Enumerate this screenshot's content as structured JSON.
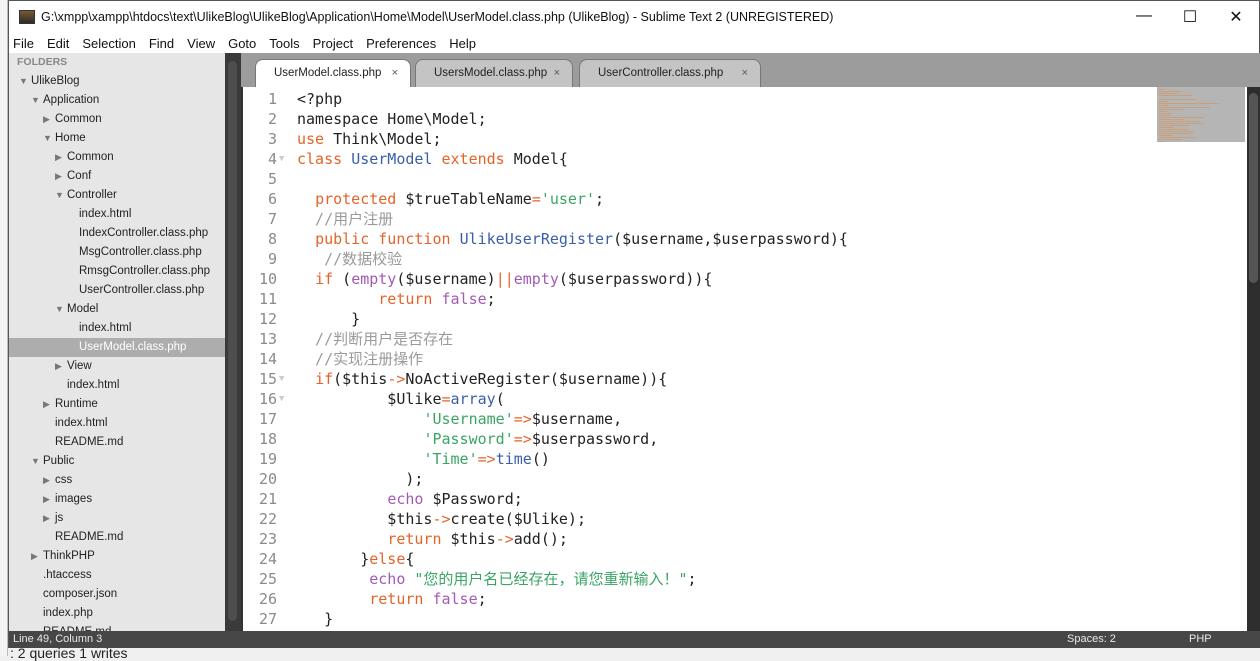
{
  "window": {
    "title": "G:\\xmpp\\xampp\\htdocs\\text\\UlikeBlog\\UlikeBlog\\Application\\Home\\Model\\UserModel.class.php (UlikeBlog) - Sublime Text 2 (UNREGISTERED)",
    "minimize": "—",
    "maximize": "☐",
    "close": "✕"
  },
  "menu": [
    "File",
    "Edit",
    "Selection",
    "Find",
    "View",
    "Goto",
    "Tools",
    "Project",
    "Preferences",
    "Help"
  ],
  "sidebar": {
    "header": "FOLDERS",
    "items": [
      {
        "label": "UlikeBlog",
        "depth": 0,
        "type": "open"
      },
      {
        "label": "Application",
        "depth": 1,
        "type": "open"
      },
      {
        "label": "Common",
        "depth": 2,
        "type": "closed"
      },
      {
        "label": "Home",
        "depth": 2,
        "type": "open"
      },
      {
        "label": "Common",
        "depth": 3,
        "type": "closed"
      },
      {
        "label": "Conf",
        "depth": 3,
        "type": "closed"
      },
      {
        "label": "Controller",
        "depth": 3,
        "type": "open"
      },
      {
        "label": "index.html",
        "depth": 4,
        "type": "file"
      },
      {
        "label": "IndexController.class.php",
        "depth": 4,
        "type": "file"
      },
      {
        "label": "MsgController.class.php",
        "depth": 4,
        "type": "file"
      },
      {
        "label": "RmsgController.class.php",
        "depth": 4,
        "type": "file"
      },
      {
        "label": "UserController.class.php",
        "depth": 4,
        "type": "file"
      },
      {
        "label": "Model",
        "depth": 3,
        "type": "open"
      },
      {
        "label": "index.html",
        "depth": 4,
        "type": "file"
      },
      {
        "label": "UserModel.class.php",
        "depth": 4,
        "type": "file",
        "selected": true
      },
      {
        "label": "View",
        "depth": 3,
        "type": "closed"
      },
      {
        "label": "index.html",
        "depth": 3,
        "type": "file"
      },
      {
        "label": "Runtime",
        "depth": 2,
        "type": "closed"
      },
      {
        "label": "index.html",
        "depth": 2,
        "type": "file"
      },
      {
        "label": "README.md",
        "depth": 2,
        "type": "file"
      },
      {
        "label": "Public",
        "depth": 1,
        "type": "open"
      },
      {
        "label": "css",
        "depth": 2,
        "type": "closed"
      },
      {
        "label": "images",
        "depth": 2,
        "type": "closed"
      },
      {
        "label": "js",
        "depth": 2,
        "type": "closed"
      },
      {
        "label": "README.md",
        "depth": 2,
        "type": "file"
      },
      {
        "label": "ThinkPHP",
        "depth": 1,
        "type": "closed"
      },
      {
        "label": ".htaccess",
        "depth": 1,
        "type": "file"
      },
      {
        "label": "composer.json",
        "depth": 1,
        "type": "file"
      },
      {
        "label": "index.php",
        "depth": 1,
        "type": "file"
      },
      {
        "label": "README.md",
        "depth": 1,
        "type": "file"
      }
    ]
  },
  "tabs": [
    {
      "label": "UserModel.class.php",
      "active": true,
      "close": "×"
    },
    {
      "label": "UsersModel.class.php",
      "close": "×"
    },
    {
      "label": "UserController.class.php",
      "close": "×"
    }
  ],
  "editor": {
    "lines": [
      {
        "n": 1,
        "t": [
          [
            "pl",
            "<?php"
          ]
        ]
      },
      {
        "n": 2,
        "t": [
          [
            "pl",
            "namespace Home\\Model;"
          ]
        ]
      },
      {
        "n": 3,
        "t": [
          [
            "kw",
            "use"
          ],
          [
            "pl",
            " Think\\Model;"
          ]
        ]
      },
      {
        "n": 4,
        "fold": true,
        "t": [
          [
            "kw",
            "class"
          ],
          [
            "pl",
            " "
          ],
          [
            "fn",
            "UserModel"
          ],
          [
            "pl",
            " "
          ],
          [
            "kw",
            "extends"
          ],
          [
            "pl",
            " Model{"
          ]
        ]
      },
      {
        "n": 5,
        "t": []
      },
      {
        "n": 6,
        "t": [
          [
            "pl",
            "  "
          ],
          [
            "kw",
            "protected"
          ],
          [
            "pl",
            " $trueTableName"
          ],
          [
            "op",
            "="
          ],
          [
            "st",
            "'user'"
          ],
          [
            "pl",
            ";"
          ]
        ]
      },
      {
        "n": 7,
        "t": [
          [
            "cm",
            "  //用户注册"
          ]
        ]
      },
      {
        "n": 8,
        "t": [
          [
            "pl",
            "  "
          ],
          [
            "kw",
            "public"
          ],
          [
            "pl",
            " "
          ],
          [
            "kw",
            "function"
          ],
          [
            "pl",
            " "
          ],
          [
            "fn",
            "UlikeUserRegister"
          ],
          [
            "pl",
            "($username,$userpassword){"
          ]
        ]
      },
      {
        "n": 9,
        "t": [
          [
            "cm",
            "   //数据校验"
          ]
        ]
      },
      {
        "n": 10,
        "t": [
          [
            "pl",
            "  "
          ],
          [
            "kw",
            "if"
          ],
          [
            "pl",
            " ("
          ],
          [
            "pu",
            "empty"
          ],
          [
            "pl",
            "($username)"
          ],
          [
            "op",
            "||"
          ],
          [
            "pu",
            "empty"
          ],
          [
            "pl",
            "($userpassword)){"
          ]
        ]
      },
      {
        "n": 11,
        "t": [
          [
            "pl",
            "         "
          ],
          [
            "kw",
            "return"
          ],
          [
            "pl",
            " "
          ],
          [
            "pu",
            "false"
          ],
          [
            "pl",
            ";"
          ]
        ]
      },
      {
        "n": 12,
        "t": [
          [
            "pl",
            "      }"
          ]
        ]
      },
      {
        "n": 13,
        "t": [
          [
            "cm",
            "  //判断用户是否存在"
          ]
        ]
      },
      {
        "n": 14,
        "t": [
          [
            "cm",
            "  //实现注册操作"
          ]
        ]
      },
      {
        "n": 15,
        "fold": true,
        "t": [
          [
            "pl",
            "  "
          ],
          [
            "kw",
            "if"
          ],
          [
            "pl",
            "($this"
          ],
          [
            "op",
            "->"
          ],
          [
            "pl",
            "NoActiveRegister($username)){"
          ]
        ]
      },
      {
        "n": 16,
        "fold": true,
        "t": [
          [
            "pl",
            "          $Ulike"
          ],
          [
            "op",
            "="
          ],
          [
            "fn",
            "array"
          ],
          [
            "pl",
            "("
          ]
        ]
      },
      {
        "n": 17,
        "t": [
          [
            "pl",
            "              "
          ],
          [
            "st",
            "'Username'"
          ],
          [
            "op",
            "=>"
          ],
          [
            "pl",
            "$username,"
          ]
        ]
      },
      {
        "n": 18,
        "t": [
          [
            "pl",
            "              "
          ],
          [
            "st",
            "'Password'"
          ],
          [
            "op",
            "=>"
          ],
          [
            "pl",
            "$userpassword,"
          ]
        ]
      },
      {
        "n": 19,
        "t": [
          [
            "pl",
            "              "
          ],
          [
            "st",
            "'Time'"
          ],
          [
            "op",
            "=>"
          ],
          [
            "fn",
            "time"
          ],
          [
            "pl",
            "()"
          ]
        ]
      },
      {
        "n": 20,
        "t": [
          [
            "pl",
            "            );"
          ]
        ]
      },
      {
        "n": 21,
        "t": [
          [
            "pl",
            "          "
          ],
          [
            "pu",
            "echo"
          ],
          [
            "pl",
            " $Password;"
          ]
        ]
      },
      {
        "n": 22,
        "t": [
          [
            "pl",
            "          $this"
          ],
          [
            "op",
            "->"
          ],
          [
            "pl",
            "create($Ulike);"
          ]
        ]
      },
      {
        "n": 23,
        "t": [
          [
            "pl",
            "          "
          ],
          [
            "kw",
            "return"
          ],
          [
            "pl",
            " $this"
          ],
          [
            "op",
            "->"
          ],
          [
            "pl",
            "add();"
          ]
        ]
      },
      {
        "n": 24,
        "t": [
          [
            "pl",
            "       }"
          ],
          [
            "kw",
            "else"
          ],
          [
            "pl",
            "{"
          ]
        ]
      },
      {
        "n": 25,
        "t": [
          [
            "pl",
            "        "
          ],
          [
            "pu",
            "echo"
          ],
          [
            "pl",
            " "
          ],
          [
            "st",
            "\"您的用户名已经存在，请您重新输入！\""
          ],
          [
            "pl",
            ";"
          ]
        ]
      },
      {
        "n": 26,
        "t": [
          [
            "pl",
            "        "
          ],
          [
            "kw",
            "return"
          ],
          [
            "pl",
            " "
          ],
          [
            "pu",
            "false"
          ],
          [
            "pl",
            ";"
          ]
        ]
      },
      {
        "n": 27,
        "t": [
          [
            "pl",
            "   }"
          ]
        ]
      }
    ]
  },
  "status": {
    "position": "Line 49, Column 3",
    "spaces": "Spaces: 2",
    "syntax": "PHP"
  },
  "background": {
    "text": ": 2 queries 1 writes"
  }
}
